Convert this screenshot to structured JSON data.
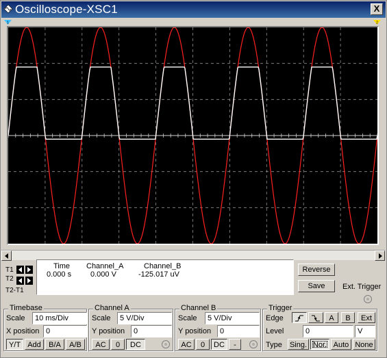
{
  "window": {
    "title": "Oscilloscope-XSC1",
    "close_label": "X"
  },
  "colors": {
    "channel_a": "#ff2020",
    "channel_b": "#ffffff",
    "grid": "#909090",
    "screen": "#000000",
    "marker_t1": "#40c0ff",
    "marker_t2": "#ffe000"
  },
  "traces": {
    "channel_a": {
      "shape": "sine",
      "amplitude_v": 15,
      "frequency_hz": 50,
      "offset_v": 0
    },
    "channel_b": {
      "shape": "clipped half-wave",
      "clip_level_v": 9.5,
      "negative_level_v": -0.5
    },
    "sweep_ms": 100,
    "volts_per_div": 5
  },
  "cursors": {
    "t1_label": "T1",
    "t2_label": "T2",
    "diff_label": "T2-T1"
  },
  "readout": {
    "headers": {
      "time": "Time",
      "channel_a": "Channel_A",
      "channel_b": "Channel_B"
    },
    "t1": {
      "time": "0.000 s",
      "channel_a": "0.000 V",
      "channel_b": "-125.017 uV"
    }
  },
  "buttons": {
    "reverse": "Reverse",
    "save": "Save",
    "ext_trigger": "Ext. Trigger"
  },
  "timebase": {
    "title": "Timebase",
    "scale_label": "Scale",
    "scale_value": "10 ms/Div",
    "xpos_label": "X position",
    "xpos_value": "0",
    "modes": [
      "Y/T",
      "Add",
      "B/A",
      "A/B"
    ]
  },
  "channel_a": {
    "title": "Channel A",
    "scale_label": "Scale",
    "scale_value": "5  V/Div",
    "ypos_label": "Y position",
    "ypos_value": "0",
    "coupling": [
      "AC",
      "0",
      "DC"
    ]
  },
  "channel_b": {
    "title": "Channel B",
    "scale_label": "Scale",
    "scale_value": "5  V/Div",
    "ypos_label": "Y position",
    "ypos_value": "0",
    "coupling": [
      "AC",
      "0",
      "DC",
      "-"
    ]
  },
  "trigger": {
    "title": "Trigger",
    "edge_label": "Edge",
    "edge_buttons": [
      "A",
      "B",
      "Ext"
    ],
    "level_label": "Level",
    "level_value": "0",
    "level_unit": "V",
    "type_label": "Type",
    "types": [
      "Sing.",
      "Nor.",
      "Auto",
      "None"
    ]
  }
}
